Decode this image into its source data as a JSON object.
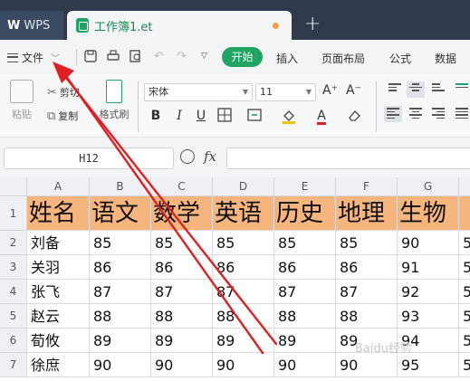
{
  "titlebar": {
    "app_label": "WPS",
    "app_mark": "W",
    "doc_tab": "工作簿1.et",
    "new_tab": "+"
  },
  "menubar": {
    "file_label": "文件",
    "start_label": "开始",
    "items": [
      "插入",
      "页面布局",
      "公式",
      "数据"
    ]
  },
  "toolbar": {
    "paste": "粘贴",
    "cut": "剪切",
    "copy": "复制",
    "format_painter": "格式刷",
    "font_name": "宋体",
    "font_size": "11",
    "bold": "B",
    "italic": "I",
    "underline": "U",
    "grow": "A⁺",
    "shrink": "A⁻",
    "font_color_glyph": "A",
    "fill_color": "#f2c200",
    "font_color": "#e02020"
  },
  "formula_bar": {
    "cell_ref": "H12",
    "fx": "fx",
    "value": ""
  },
  "sheet": {
    "columns": [
      "A",
      "B",
      "C",
      "D",
      "E",
      "F",
      "G"
    ],
    "rows": [
      "1",
      "2",
      "3",
      "4",
      "5",
      "6",
      "7"
    ],
    "header_fill": "#f6b57c",
    "header": [
      "姓名",
      "语文",
      "数学",
      "英语",
      "历史",
      "地理",
      "生物"
    ],
    "data": [
      [
        "刘备",
        "85",
        "85",
        "85",
        "85",
        "85",
        "90"
      ],
      [
        "关羽",
        "86",
        "86",
        "86",
        "86",
        "86",
        "91"
      ],
      [
        "张飞",
        "87",
        "87",
        "87",
        "87",
        "87",
        "92"
      ],
      [
        "赵云",
        "88",
        "88",
        "88",
        "88",
        "88",
        "93"
      ],
      [
        "荀攸",
        "89",
        "89",
        "89",
        "89",
        "89",
        "94"
      ],
      [
        "徐庶",
        "90",
        "90",
        "90",
        "90",
        "90",
        "95"
      ]
    ],
    "overflow_digit": "5"
  },
  "annotation_color": "#e02020",
  "watermark": "Baidu经验"
}
